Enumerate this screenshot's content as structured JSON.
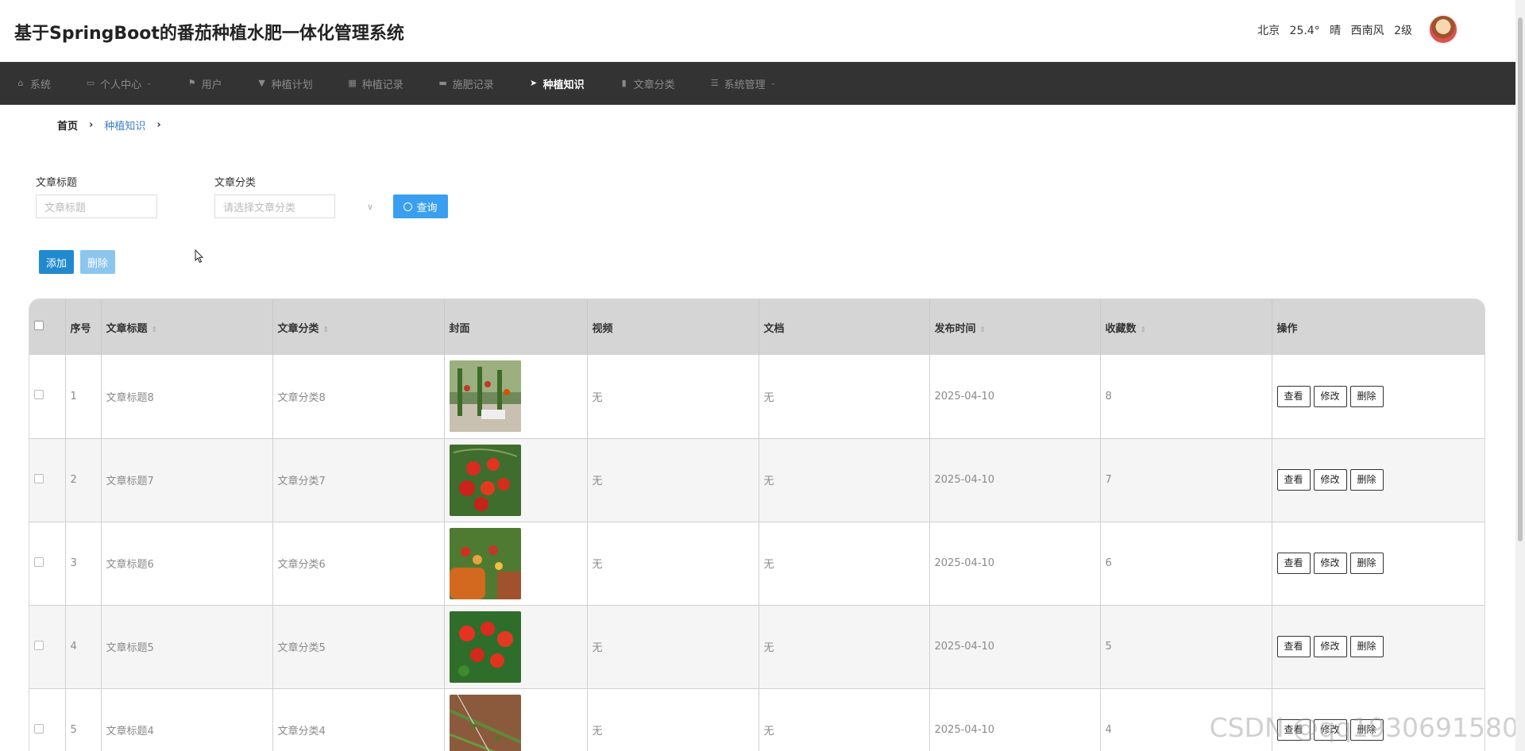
{
  "header": {
    "title": "基于SpringBoot的番茄种植水肥一体化管理系统",
    "weather": {
      "city": "北京",
      "temp": "25.4°",
      "condition": "晴",
      "wind": "西南风",
      "level": "2级"
    }
  },
  "nav": [
    {
      "label": "系统",
      "icon": "home-icon"
    },
    {
      "label": "个人中心",
      "icon": "calendar-icon",
      "caret": "⌄"
    },
    {
      "label": "用户",
      "icon": "flag-icon"
    },
    {
      "label": "种植计划",
      "icon": "trophy-icon"
    },
    {
      "label": "种植记录",
      "icon": "grid-icon"
    },
    {
      "label": "施肥记录",
      "icon": "chat-icon"
    },
    {
      "label": "种植知识",
      "icon": "send-icon"
    },
    {
      "label": "文章分类",
      "icon": "clipboard-icon"
    },
    {
      "label": "系统管理",
      "icon": "sliders-icon",
      "caret": "⌄"
    }
  ],
  "breadcrumb": {
    "home": "首页",
    "current": "种植知识",
    "sep": "›"
  },
  "search": {
    "title_label": "文章标题",
    "title_placeholder": "文章标题",
    "category_label": "文章分类",
    "category_placeholder": "请选择文章分类",
    "query_label": "查询"
  },
  "actions": {
    "add_label": "添加",
    "delete_label": "删除"
  },
  "table": {
    "headers": [
      "序号",
      "文章标题",
      "文章分类",
      "封面",
      "视频",
      "文档",
      "发布时间",
      "收藏数",
      "操作"
    ],
    "rows": [
      {
        "index": "1",
        "title": "文章标题8",
        "category": "文章分类8",
        "video": "无",
        "doc": "无",
        "date": "2025-04-10",
        "favorites": "8"
      },
      {
        "index": "2",
        "title": "文章标题7",
        "category": "文章分类7",
        "video": "无",
        "doc": "无",
        "date": "2025-04-10",
        "favorites": "7"
      },
      {
        "index": "3",
        "title": "文章标题6",
        "category": "文章分类6",
        "video": "无",
        "doc": "无",
        "date": "2025-04-10",
        "favorites": "6"
      },
      {
        "index": "4",
        "title": "文章标题5",
        "category": "文章分类5",
        "video": "无",
        "doc": "无",
        "date": "2025-04-10",
        "favorites": "5"
      },
      {
        "index": "5",
        "title": "文章标题4",
        "category": "文章分类4",
        "video": "无",
        "doc": "无",
        "date": "2025-04-10",
        "favorites": "4"
      }
    ],
    "row_actions": {
      "view": "查看",
      "edit": "修改",
      "delete": "删除"
    }
  },
  "watermark": "CSDN @qq1930691580"
}
